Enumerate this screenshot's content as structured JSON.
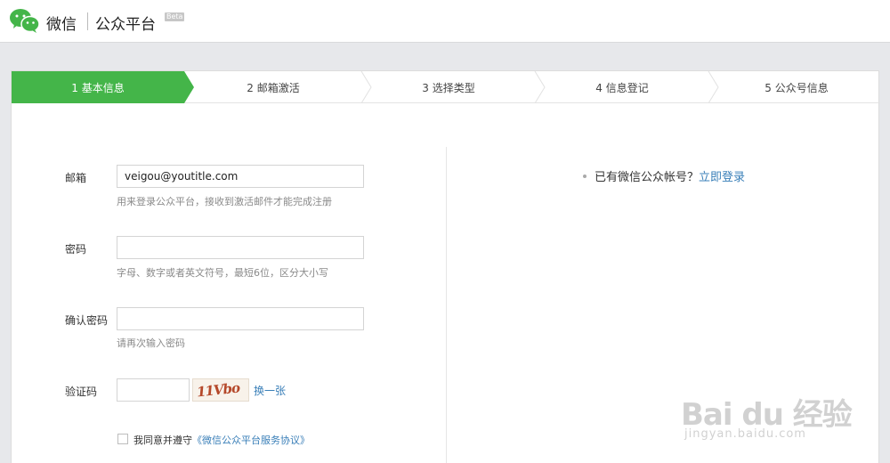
{
  "header": {
    "brand_wechat": "微信",
    "brand_platform": "公众平台",
    "beta": "Beta"
  },
  "steps": [
    {
      "label": "1 基本信息",
      "active": true
    },
    {
      "label": "2 邮箱激活",
      "active": false
    },
    {
      "label": "3 选择类型",
      "active": false
    },
    {
      "label": "4 信息登记",
      "active": false
    },
    {
      "label": "5 公众号信息",
      "active": false
    }
  ],
  "form": {
    "email": {
      "label": "邮箱",
      "value": "veigou@youtitle.com",
      "hint": "用来登录公众平台，接收到激活邮件才能完成注册"
    },
    "password": {
      "label": "密码",
      "value": "",
      "hint": "字母、数字或者英文符号，最短6位，区分大小写"
    },
    "confirm": {
      "label": "确认密码",
      "value": "",
      "hint": "请再次输入密码"
    },
    "captcha": {
      "label": "验证码",
      "value": "",
      "image_text": "11Vbo",
      "refresh": "换一张"
    },
    "agreement": {
      "text": "我同意并遵守",
      "link": "《微信公众平台服务协议》"
    }
  },
  "aside": {
    "text": "已有微信公众帐号？",
    "link": "立即登录"
  },
  "watermark": {
    "main": "Bai du 经验",
    "sub": "jingyan.baidu.com"
  },
  "colors": {
    "accent_green": "#44b549",
    "link_blue": "#3a7fb8"
  }
}
